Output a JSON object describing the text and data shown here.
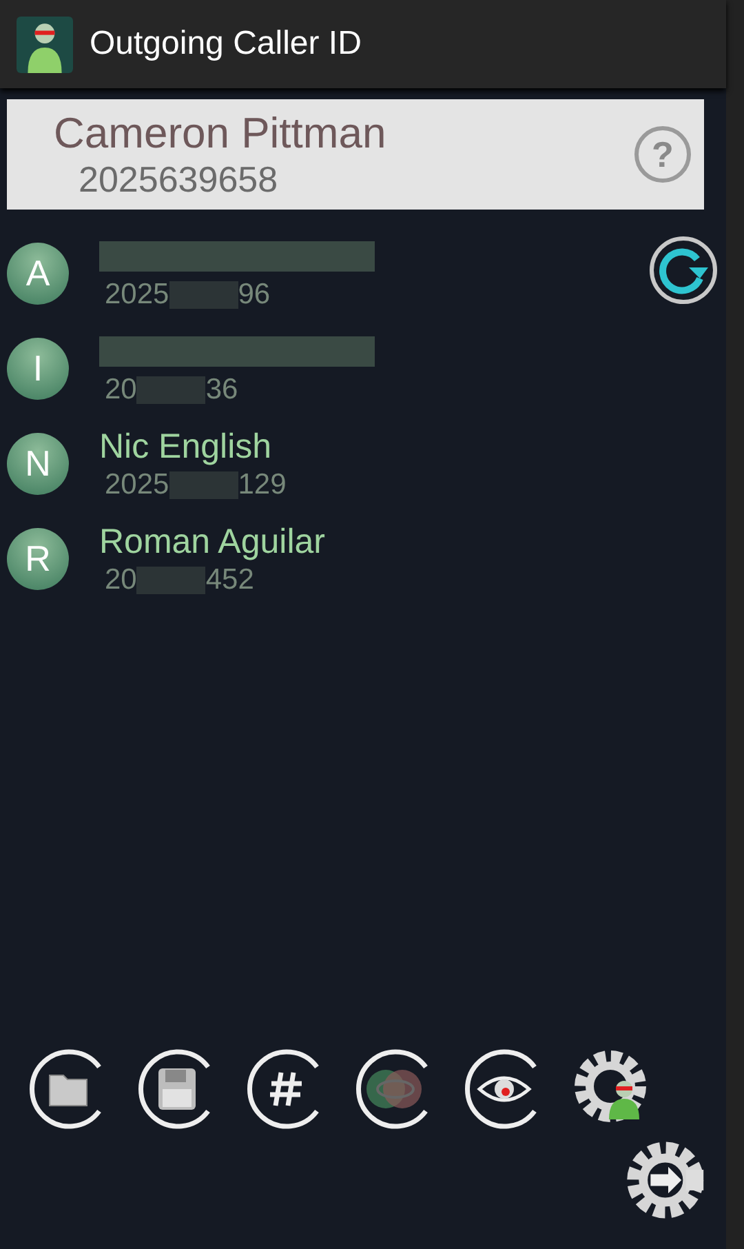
{
  "app_bar": {
    "title": "Outgoing Caller ID"
  },
  "current_id": {
    "name": "Cameron Pittman",
    "number": "2025639658",
    "help_symbol": "?"
  },
  "contacts": [
    {
      "initial": "A",
      "name_redacted": true,
      "number_start": "2025",
      "number_end": "96"
    },
    {
      "initial": "I",
      "name_redacted": true,
      "number_start": "20",
      "number_end": "36"
    },
    {
      "initial": "N",
      "name": "Nic English",
      "name_redacted": false,
      "number_start": "2025",
      "number_end": "129"
    },
    {
      "initial": "R",
      "name": "Roman Aguilar",
      "name_redacted": false,
      "number_start": "20",
      "number_end": "452"
    }
  ],
  "toolbar": [
    {
      "kind": "folder"
    },
    {
      "kind": "save"
    },
    {
      "kind": "hash"
    },
    {
      "kind": "hidden"
    },
    {
      "kind": "eye"
    },
    {
      "kind": "settings"
    }
  ]
}
